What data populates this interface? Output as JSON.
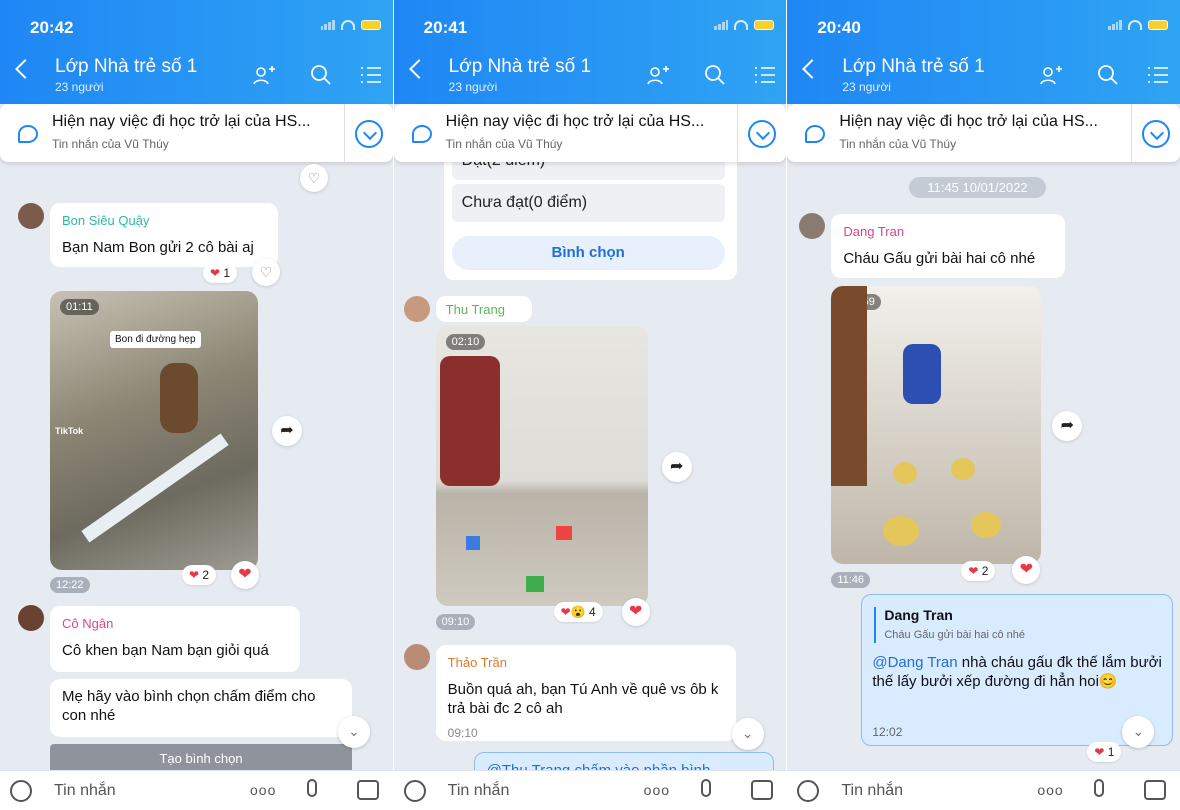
{
  "panels": [
    {
      "time": "20:42",
      "header": {
        "title": "Lớp Nhà trẻ số 1",
        "subtitle": "23 người"
      },
      "pinned": {
        "title": "Hiện nay việc đi học trở lại của HS...",
        "sub": "Tin nhắn của Vũ Thúy"
      },
      "messages": {
        "m1": {
          "sender": "Bon Siêu Quậy",
          "sender_color": "#2eb8a3",
          "text": "Bạn Nam Bon gửi 2 cô bài aj",
          "reaction": "1"
        },
        "video": {
          "duration": "01:11",
          "caption": "Bon đi đường hẹp",
          "time": "12:22",
          "reaction": "2",
          "tiktok": "TikTok"
        },
        "m2": {
          "sender": "Cô Ngân",
          "sender_color": "#d9488b",
          "text": "Cô khen bạn Nam bạn giỏi quá"
        },
        "m3": {
          "text": "Mẹ hãy vào bình chọn chấm điểm cho con nhé"
        },
        "button": "Tạo bình chọn"
      },
      "input_placeholder": "Tin nhắn"
    },
    {
      "time": "20:41",
      "header": {
        "title": "Lớp Nhà trẻ số 1",
        "subtitle": "23 người"
      },
      "pinned": {
        "title": "Hiện nay việc đi học trở lại của HS...",
        "sub": "Tin nhắn của Vũ Thúy"
      },
      "poll": {
        "options": [
          "Đạt(2 điểm)",
          "Chưa đạt(0 điểm)"
        ],
        "vote": "Bình chọn"
      },
      "messages": {
        "sender_video": {
          "name": "Thu Trang",
          "color": "#57b85a"
        },
        "video": {
          "duration": "02:10",
          "time": "09:10",
          "reaction": "4"
        },
        "m1": {
          "sender": "Thảo Trần",
          "sender_color": "#e0792b",
          "text": "Buồn quá ah, bạn Tú Anh về quê vs ôb k trả bài đc 2 cô ah",
          "time": "09:10"
        },
        "m2": {
          "text": "@Thu Trang  chấm vào phần bình"
        }
      },
      "input_placeholder": "Tin nhắn"
    },
    {
      "time": "20:40",
      "header": {
        "title": "Lớp Nhà trẻ số 1",
        "subtitle": "23 người"
      },
      "pinned": {
        "title": "Hiện nay việc đi học trở lại của HS...",
        "sub": "Tin nhắn của Vũ Thúy"
      },
      "date_pill": "11:45 10/01/2022",
      "messages": {
        "m1": {
          "sender": "Dang Tran",
          "sender_color": "#d9488b",
          "text": "Cháu Gấu gửi bài hai cô nhé"
        },
        "video": {
          "duration": "00:59",
          "time": "11:46",
          "reaction": "2"
        },
        "reply": {
          "quote_name": "Dang Tran",
          "quote_text": "Cháu Gấu gửi bài hai cô nhé",
          "mention": "@Dang Tran",
          "text": " nhà cháu gấu đk thế lắm bưởi thế lấy bưởi xếp đường đi hẳn hoi😊",
          "time": "12:02",
          "reaction": "1"
        }
      },
      "input_placeholder": "Tin nhắn"
    }
  ],
  "icons": [
    "back-icon",
    "add-member-icon",
    "search-icon",
    "menu-icon",
    "chat-bubble-icon",
    "chevron-down-icon",
    "share-icon",
    "heart-icon",
    "emoji-icon",
    "more-icon",
    "mic-icon",
    "image-icon"
  ],
  "colors": {
    "header_blue": "#1f87f5",
    "bg": "#e6eaf1",
    "heart": "#e63946"
  }
}
